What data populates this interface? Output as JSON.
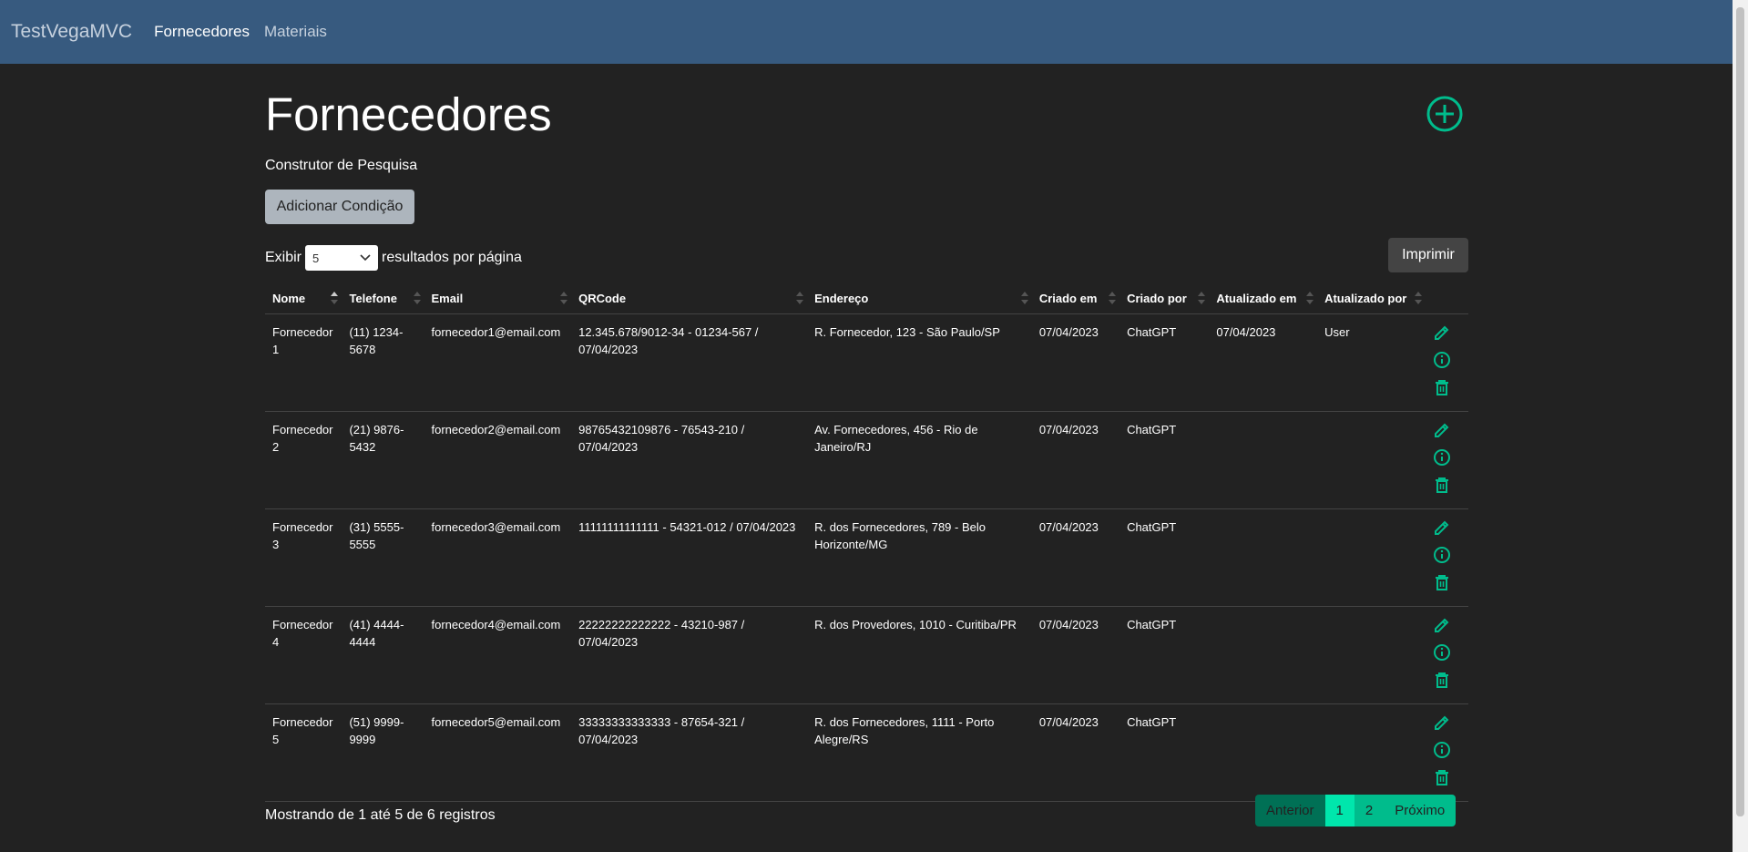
{
  "nav": {
    "brand": "TestVegaMVC",
    "links": [
      "Fornecedores",
      "Materiais"
    ]
  },
  "page": {
    "title": "Fornecedores",
    "builder_label": "Construtor de Pesquisa",
    "add_condition_label": "Adicionar Condição",
    "print_label": "Imprimir",
    "show_label": "Exibir",
    "page_size": "5",
    "per_page_label": "resultados por página",
    "info": "Mostrando de 1 até 5 de 6 registros"
  },
  "table": {
    "headers": [
      "Nome",
      "Telefone",
      "Email",
      "QRCode",
      "Endereço",
      "Criado em",
      "Criado por",
      "Atualizado em",
      "Atualizado por"
    ],
    "rows": [
      [
        "Fornecedor 1",
        "(11) 1234-5678",
        "fornecedor1@email.com",
        "12.345.678/9012-34 - 01234-567 / 07/04/2023",
        "R. Fornecedor, 123 - São Paulo/SP",
        "07/04/2023",
        "ChatGPT",
        "07/04/2023",
        "User"
      ],
      [
        "Fornecedor 2",
        "(21) 9876-5432",
        "fornecedor2@email.com",
        "98765432109876 - 76543-210 / 07/04/2023",
        "Av. Fornecedores, 456 - Rio de Janeiro/RJ",
        "07/04/2023",
        "ChatGPT",
        "",
        ""
      ],
      [
        "Fornecedor 3",
        "(31) 5555-5555",
        "fornecedor3@email.com",
        "11111111111111 - 54321-012 / 07/04/2023",
        "R. dos Fornecedores, 789 - Belo Horizonte/MG",
        "07/04/2023",
        "ChatGPT",
        "",
        ""
      ],
      [
        "Fornecedor 4",
        "(41) 4444-4444",
        "fornecedor4@email.com",
        "22222222222222 - 43210-987 / 07/04/2023",
        "R. dos Provedores, 1010 - Curitiba/PR",
        "07/04/2023",
        "ChatGPT",
        "",
        ""
      ],
      [
        "Fornecedor 5",
        "(51) 9999-9999",
        "fornecedor5@email.com",
        "33333333333333 - 87654-321 / 07/04/2023",
        "R. dos Fornecedores, 1111 - Porto Alegre/RS",
        "07/04/2023",
        "ChatGPT",
        "",
        ""
      ]
    ]
  },
  "pagination": {
    "prev": "Anterior",
    "pages": [
      "1",
      "2"
    ],
    "active": "1",
    "next": "Próximo"
  },
  "colors": {
    "navbar": "#375a7f",
    "background": "#222222",
    "accent": "#00bc8c"
  },
  "icons": {
    "row_actions": [
      "pencil-icon",
      "info-icon",
      "trash-icon"
    ],
    "add": "plus-circle-icon"
  }
}
